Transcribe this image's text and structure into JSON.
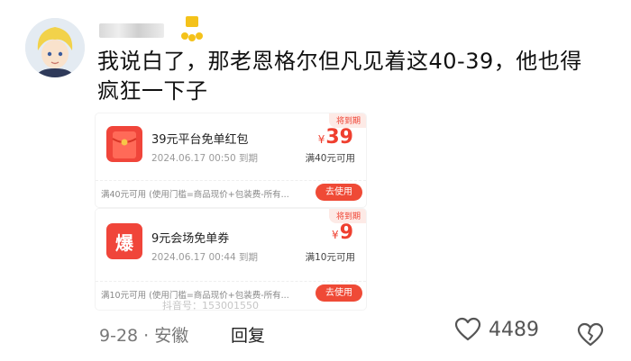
{
  "comment": {
    "username": "",
    "text": "我说白了，那老恩格尔但凡见着这40-39，他也得疯狂一下子",
    "date_location": "9-28 · 安徽",
    "reply_label": "回复",
    "like_count": "4489",
    "watermark": "抖音号：153001550"
  },
  "coupons": [
    {
      "name": "39元平台免单红包",
      "date": "2024.06.17 00:50 到期",
      "currency": "¥",
      "amount": "39",
      "condition": "满40元可用",
      "expire_tag": "将到期",
      "rule": "满40元可用 (使用门槛=商品现价+包装费-所有...",
      "button": "去使用",
      "icon": "red-envelope-icon"
    },
    {
      "name": "9元会场免单券",
      "date": "2024.06.17 00:44 到期",
      "currency": "¥",
      "amount": "9",
      "condition": "满10元可用",
      "expire_tag": "将到期",
      "rule": "满10元可用 (使用门槛=商品现价+包装费-所有...",
      "button": "去使用",
      "icon": "bao-icon",
      "icon_text": "爆"
    }
  ],
  "colors": {
    "accent_red": "#ef3f2f",
    "button_red": "#ef4a36",
    "meta_gray": "#777777"
  }
}
